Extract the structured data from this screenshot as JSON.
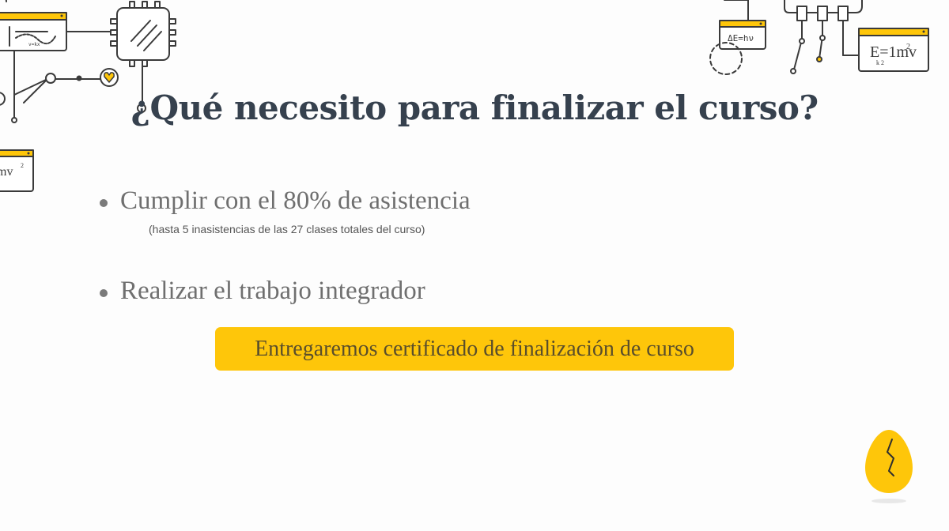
{
  "slide": {
    "title": "¿Qué necesito para finalizar el curso?",
    "items": [
      {
        "text": "Cumplir con el 80% de asistencia",
        "note": "(hasta 5 inasistencias de las 27 clases totales del curso)"
      },
      {
        "text": "Realizar el trabajo integrador"
      }
    ],
    "banner": "Entregaremos certificado de finalización de curso"
  },
  "decor": {
    "formula_photon": "ΔE=hν",
    "formula_kinetic_main": "E=1mv",
    "formula_kinetic_sub": "k 2",
    "formula_partial": "mv",
    "sketch_label": "v=kx"
  },
  "colors": {
    "accent": "#fec60a",
    "title": "#36414e",
    "body_text": "#6f6f6f",
    "sketch_line": "#3a3a3a"
  },
  "icons": [
    "circuit-chip-icon",
    "heart-icon",
    "cracked-egg-icon"
  ]
}
